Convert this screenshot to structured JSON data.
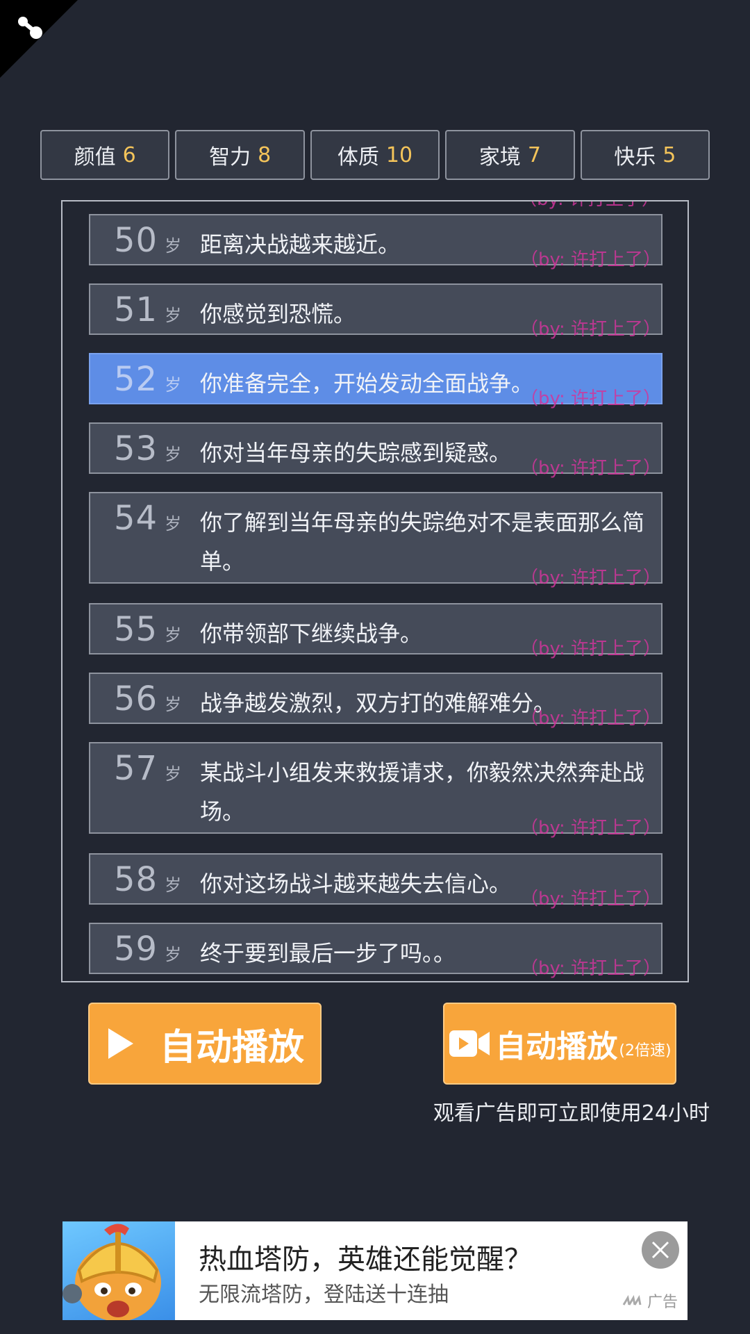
{
  "stats": [
    {
      "label": "颜值",
      "value": "6"
    },
    {
      "label": "智力",
      "value": "8"
    },
    {
      "label": "体质",
      "value": "10"
    },
    {
      "label": "家境",
      "value": "7"
    },
    {
      "label": "快乐",
      "value": "5"
    }
  ],
  "events": {
    "age_unit": "岁",
    "author": "（by: 许打上了）",
    "items": [
      {
        "age": "50",
        "text": "距离决战越来越近。"
      },
      {
        "age": "51",
        "text": "你感觉到恐慌。"
      },
      {
        "age": "52",
        "text": "你准备完全，开始发动全面战争。"
      },
      {
        "age": "53",
        "text": "你对当年母亲的失踪感到疑惑。"
      },
      {
        "age": "54",
        "text": "你了解到当年母亲的失踪绝对不是表面那么简单。"
      },
      {
        "age": "55",
        "text": "你带领部下继续战争。"
      },
      {
        "age": "56",
        "text": "战争越发激烈，双方打的难解难分。"
      },
      {
        "age": "57",
        "text": "某战斗小组发来救援请求，你毅然决然奔赴战场。"
      },
      {
        "age": "58",
        "text": "你对这场战斗越来越失去信心。"
      },
      {
        "age": "59",
        "text": "终于要到最后一步了吗。。"
      }
    ]
  },
  "buttons": {
    "auto_play": "自动播放",
    "auto_play_fast": "自动播放",
    "auto_play_fast_sub": "(2倍速)",
    "ad_note": "观看广告即可立即使用24小时"
  },
  "ad": {
    "title": "热血塔防，英雄还能觉醒？",
    "subtitle": "无限流塔防，登陆送十连抽",
    "tag": "广告"
  },
  "colors": {
    "background": "#222631",
    "highlight_row": "#5e8de6",
    "stat_value": "#f4c45a",
    "button": "#f8a53b",
    "author_text": "#d0359b"
  }
}
